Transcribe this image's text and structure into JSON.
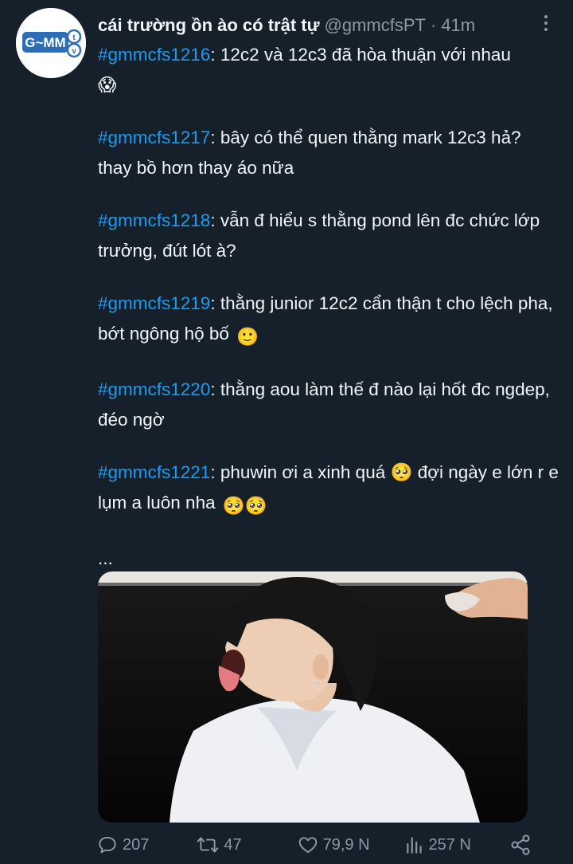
{
  "tweet": {
    "avatar_text": "G~MM",
    "avatar_sub": "TV",
    "display_name": "cái trường ồn ào có trật tự",
    "handle": "@gmmcfsPT",
    "separator": "·",
    "time": "41m",
    "paragraphs": [
      {
        "tag": "#gmmcfs1216",
        "text": ": 12c2 và 12c3 đã hòa thuận với nhau",
        "emoji": "😱"
      },
      {
        "tag": "#gmmcfs1217",
        "text": ": bây có thể quen thằng mark 12c3 hả? thay bồ hơn thay áo nữa",
        "emoji": ""
      },
      {
        "tag": "#gmmcfs1218",
        "text": ": vẫn đ hiểu s thằng pond lên đc chức lớp trưởng, đút lót à?",
        "emoji": ""
      },
      {
        "tag": "#gmmcfs1219",
        "text": ": thằng junior 12c2 cẩn thận t cho lệch pha, bớt ngông hộ bố",
        "emoji": "🙂"
      },
      {
        "tag": "#gmmcfs1220",
        "text": ": thằng aou làm thế đ nào lại hốt đc ngdep, đéo ngờ",
        "emoji": ""
      },
      {
        "tag": "#gmmcfs1221",
        "text": ": phuwin ơi a xinh quá 🥺 đợi ngày e lớn r e lụm a luôn nha",
        "emoji": "🥺🥺"
      }
    ],
    "ellipsis": "..."
  },
  "actions": {
    "replies": "207",
    "retweets": "47",
    "likes": "79,9 N",
    "views": "257 N"
  },
  "colors": {
    "background": "#15202b",
    "text": "#f1f5f9",
    "secondary": "#8b98a5",
    "link": "#1d9bf0"
  },
  "icons": [
    "more-vertical-icon",
    "reply-icon",
    "retweet-icon",
    "like-icon",
    "views-icon",
    "share-icon"
  ]
}
